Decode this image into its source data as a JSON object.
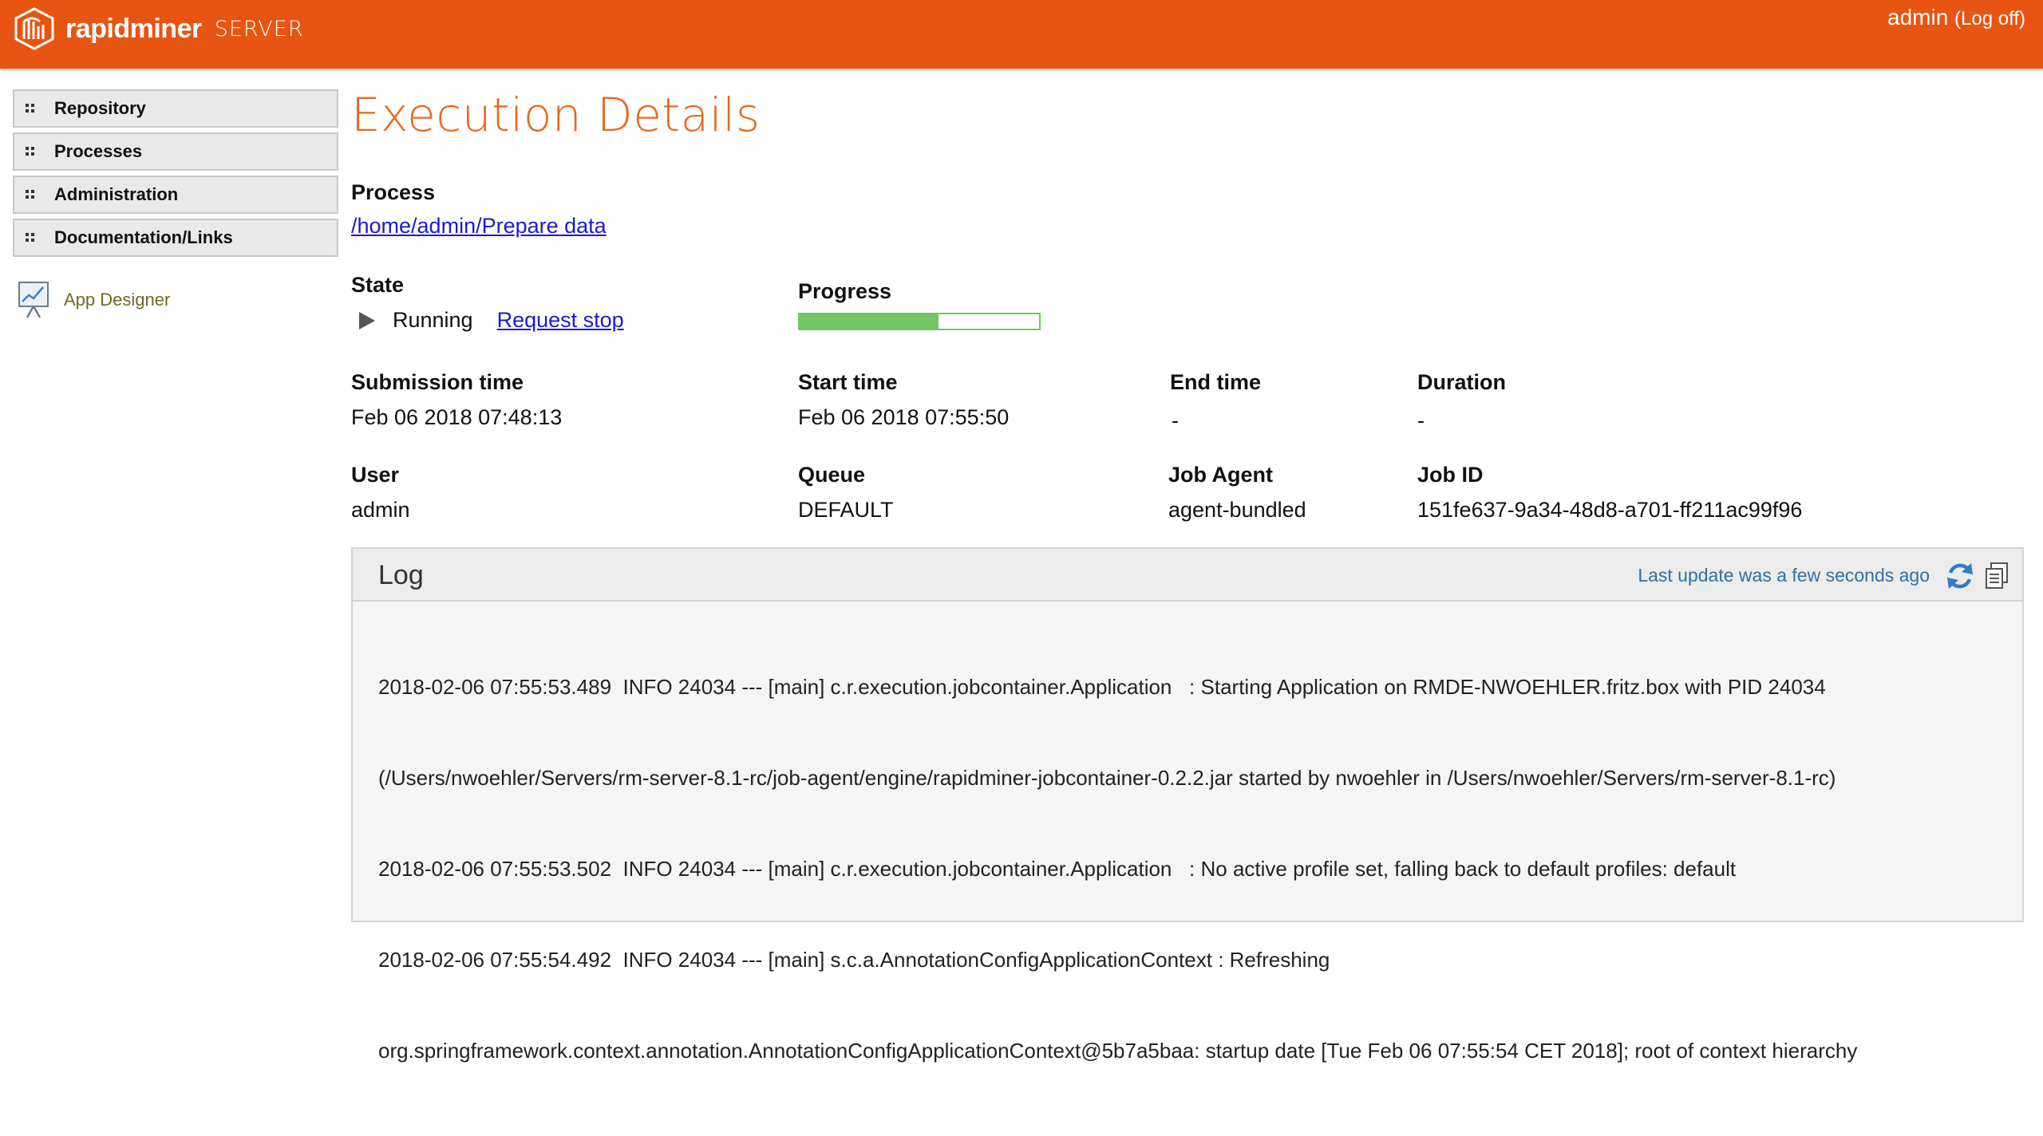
{
  "header": {
    "brand": "rapidminer",
    "product": "SERVER",
    "user": "admin",
    "logoff": "(Log off)"
  },
  "sidebar": {
    "items": [
      {
        "label": "Repository"
      },
      {
        "label": "Processes"
      },
      {
        "label": "Administration"
      },
      {
        "label": "Documentation/Links"
      }
    ],
    "app_designer": "App Designer"
  },
  "main": {
    "title": "Execution Details",
    "process_label": "Process",
    "process_path": "/home/admin/Prepare data",
    "state_label": "State",
    "state_value": "Running",
    "request_stop": "Request stop",
    "progress_label": "Progress",
    "progress_fraction": 0.58,
    "submission_label": "Submission time",
    "submission_value": "Feb 06 2018 07:48:13",
    "start_label": "Start time",
    "start_value": "Feb 06 2018 07:55:50",
    "end_label": "End time",
    "end_value": "-",
    "duration_label": "Duration",
    "duration_value": "-",
    "user_label": "User",
    "user_value": "admin",
    "queue_label": "Queue",
    "queue_value": "DEFAULT",
    "agent_label": "Job Agent",
    "agent_value": "agent-bundled",
    "jobid_label": "Job ID",
    "jobid_value": "151fe637-9a34-48d8-a701-ff211ac99f96"
  },
  "log": {
    "title": "Log",
    "last_update": "Last update was a few seconds ago",
    "lines": [
      "2018-02-06 07:55:53.489  INFO 24034 --- [main] c.r.execution.jobcontainer.Application   : Starting Application on RMDE-NWOEHLER.fritz.box with PID 24034",
      "(/Users/nwoehler/Servers/rm-server-8.1-rc/job-agent/engine/rapidminer-jobcontainer-0.2.2.jar started by nwoehler in /Users/nwoehler/Servers/rm-server-8.1-rc)",
      "2018-02-06 07:55:53.502  INFO 24034 --- [main] c.r.execution.jobcontainer.Application   : No active profile set, falling back to default profiles: default",
      "2018-02-06 07:55:54.492  INFO 24034 --- [main] s.c.a.AnnotationConfigApplicationContext : Refreshing",
      "org.springframework.context.annotation.AnnotationConfigApplicationContext@5b7a5baa: startup date [Tue Feb 06 07:55:54 CET 2018]; root of context hierarchy"
    ]
  },
  "colors": {
    "brand": "#e85412",
    "title": "#e8691c",
    "progress": "#72c664",
    "link": "#1b1bd0"
  }
}
